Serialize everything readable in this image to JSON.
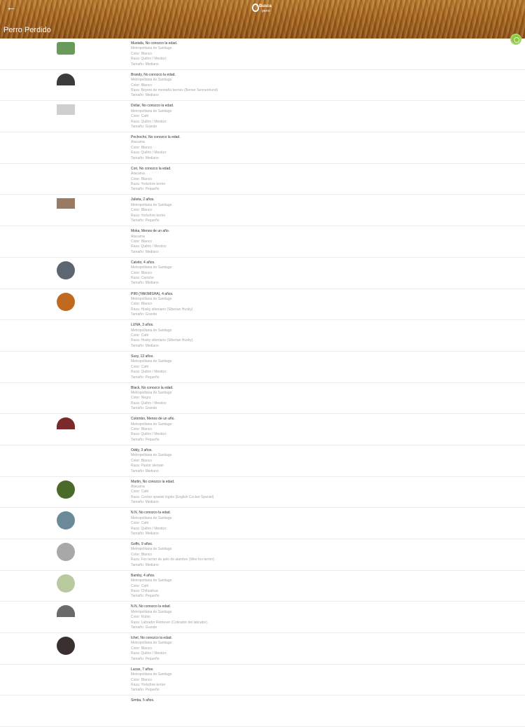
{
  "header": {
    "title": "Perro Perdido",
    "logo_line1": "Busca",
    "logo_line2": "perro"
  },
  "rows": [
    {
      "name": "Mustafa, No conozco la edad.",
      "region": "Metropolitana de Santiago",
      "color": "Color: Blanco",
      "breed": "Raza: Quiltro / Mestizo",
      "size": "Tamaño: Mediano",
      "thumb": "#6a9a5a"
    },
    {
      "name": "Brandy, No conozco la edad.",
      "region": "Metropolitana de Santiago",
      "color": "Color: Blanco",
      "breed": "Raza: Boyero de montaña bernes (Berner Sennenhund)",
      "size": "Tamaño: Mediano",
      "thumb": "#3b3b3b"
    },
    {
      "name": "Dollar, No conozco la edad.",
      "region": "Metropolitana de Santiago",
      "color": "Color: Café",
      "breed": "Raza: Quiltro / Mestizo",
      "size": "Tamaño: Grande",
      "thumb": "#cfcfcf"
    },
    {
      "name": "Pechocho, No conozco la edad.",
      "region": "Atacama",
      "color": "Color: Blanco",
      "breed": "Raza: Quiltro / Mestizo",
      "size": "Tamaño: Mediano",
      "thumb": ""
    },
    {
      "name": "Cori, No conozco la edad.",
      "region": "Atacama",
      "color": "Color: Blanco",
      "breed": "Raza: Yorkshire terrier",
      "size": "Tamaño: Pequeño",
      "thumb": ""
    },
    {
      "name": "Julieta, 2 años.",
      "region": "Metropolitana de Santiago",
      "color": "Color: Blanco",
      "breed": "Raza: Yorkshire terrier",
      "size": "Tamaño: Pequeño",
      "thumb": "#9a7a60"
    },
    {
      "name": "Moka, Menos de un año.",
      "region": "Atacama",
      "color": "Color: Blanco",
      "breed": "Raza: Quiltro / Mestizo",
      "size": "Tamaño: Mediano",
      "thumb": ""
    },
    {
      "name": "Calvito, 4 años.",
      "region": "Metropolitana de Santiago",
      "color": "Color: Blanco",
      "breed": "Raza: Caniche",
      "size": "Tamaño: Mediano",
      "thumb": "#5c6670"
    },
    {
      "name": "PIRI (YAKIMISHA), 4 años.",
      "region": "Metropolitana de Santiago",
      "color": "Color: Blanco",
      "breed": "Raza: Husky siberiano (Siberian Husky)",
      "size": "Tamaño: Grande",
      "thumb": "#c06a20"
    },
    {
      "name": "LUNA, 3 años.",
      "region": "Metropolitana de Santiago",
      "color": "Color: Café",
      "breed": "Raza: Husky siberiano (Siberian Husky)",
      "size": "Tamaño: Mediano",
      "thumb": ""
    },
    {
      "name": "Susy, 13 años.",
      "region": "Metropolitana de Santiago",
      "color": "Color: Café",
      "breed": "Raza: Quiltro / Mestizo",
      "size": "Tamaño: Pequeño",
      "thumb": ""
    },
    {
      "name": "Black, No conozco la edad.",
      "region": "Metropolitana de Santiago",
      "color": "Color: Negro",
      "breed": "Raza: Quiltro / Mestizo",
      "size": "Tamaño: Grande",
      "thumb": ""
    },
    {
      "name": "Colombo, Menos de un año.",
      "region": "Metropolitana de Santiago",
      "color": "Color: Blanco",
      "breed": "Raza: Quiltro / Mestizo",
      "size": "Tamaño: Pequeño",
      "thumb": "#7a2a2a"
    },
    {
      "name": "Oddy, 3 años.",
      "region": "Metropolitana de Santiago",
      "color": "Color: Blanco",
      "breed": "Raza: Pastor alemán",
      "size": "Tamaño: Mediano",
      "thumb": ""
    },
    {
      "name": "Martin, No conozco la edad.",
      "region": "Atacama",
      "color": "Color: Café",
      "breed": "Raza: Cocker spaniel inglés (English Cocker Spaniel)",
      "size": "Tamaño: Mediano",
      "thumb": "#4a6a2a"
    },
    {
      "name": "N.N, No conozco la edad.",
      "region": "Metropolitana de Santiago",
      "color": "Color: Café",
      "breed": "Raza: Quiltro / Mestizo",
      "size": "Tamaño: Mediano",
      "thumb": "#6a8a9a"
    },
    {
      "name": "Goffo, 9 años.",
      "region": "Metropolitana de Santiago",
      "color": "Color: Blanco",
      "breed": "Raza: Fox terrier de pelo de alambre (Wire fox terrier)",
      "size": "Tamaño: Mediano",
      "thumb": "#a8a8a8"
    },
    {
      "name": "Bamby, 4 años.",
      "region": "Metropolitana de Santiago",
      "color": "Color: Café",
      "breed": "Raza: Chihuahua",
      "size": "Tamaño: Pequeño",
      "thumb": "#b9c9a0"
    },
    {
      "name": "N.N, No conozco la edad.",
      "region": "Metropolitana de Santiago",
      "color": "Color: Rubio",
      "breed": "Raza: Labrador Retriever (Cobrador del labrador)",
      "size": "Tamaño: Grande",
      "thumb": "#6a6a6a"
    },
    {
      "name": "Ichel, No conozco la edad.",
      "region": "Metropolitana de Santiago",
      "color": "Color: Blanco",
      "breed": "Raza: Quiltro / Mestizo",
      "size": "Tamaño: Pequeño",
      "thumb": "#3a3030"
    },
    {
      "name": "Lucas, 7 años.",
      "region": "Metropolitana de Santiago",
      "color": "Color: Blanco",
      "breed": "Raza: Yorkshire terrier",
      "size": "Tamaño: Pequeño",
      "thumb": ""
    },
    {
      "name": "Simba, 5 años.",
      "region": "",
      "color": "",
      "breed": "",
      "size": "",
      "thumb": ""
    }
  ]
}
